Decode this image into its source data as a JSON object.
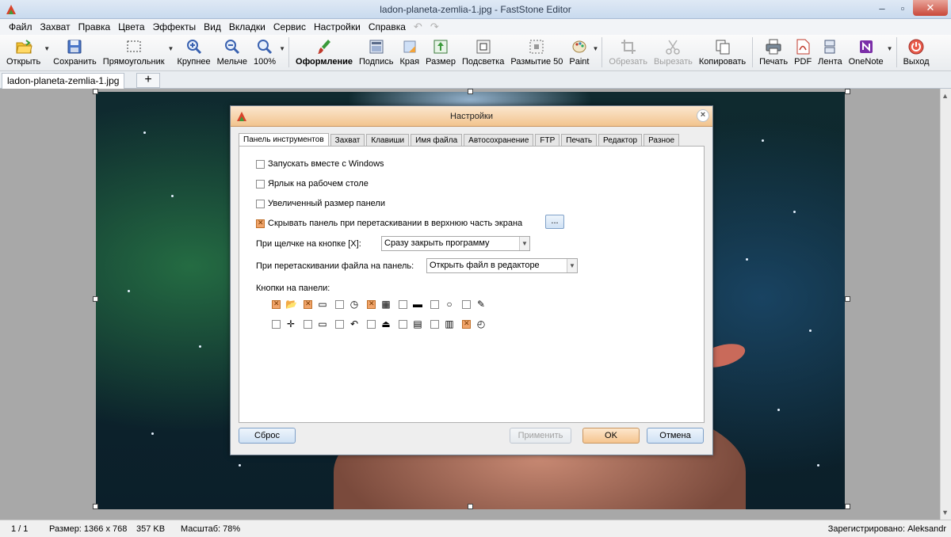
{
  "window": {
    "title": "ladon-planeta-zemlia-1.jpg - FastStone Editor"
  },
  "menu": [
    "Файл",
    "Захват",
    "Правка",
    "Цвета",
    "Эффекты",
    "Вид",
    "Вкладки",
    "Сервис",
    "Настройки",
    "Справка"
  ],
  "toolbar": {
    "open": "Открыть",
    "save": "Сохранить",
    "rect": "Прямоугольник",
    "zoom_in": "Крупнее",
    "zoom_out": "Мельче",
    "zoom_level": "100%",
    "decor": "Оформление",
    "caption": "Подпись",
    "edges": "Края",
    "resize": "Размер",
    "highlight": "Подсветка",
    "blur": "Размытие 50",
    "paint": "Paint",
    "crop": "Обрезать",
    "cut": "Вырезать",
    "copy": "Копировать",
    "print": "Печать",
    "pdf": "PDF",
    "tape": "Лента",
    "onenote": "OneNote",
    "exit": "Выход"
  },
  "tabs": {
    "file_tab": "ladon-planeta-zemlia-1.jpg",
    "add": "+"
  },
  "status": {
    "page": "1 / 1",
    "size": "Размер: 1366 x 768",
    "filesize": "357 KB",
    "zoom": "Масштаб: 78%",
    "registered": "Зарегистрировано: Aleksandr"
  },
  "dialog": {
    "title": "Настройки",
    "tabs": [
      "Панель инструментов",
      "Захват",
      "Клавиши",
      "Имя файла",
      "Автосохранение",
      "FTP",
      "Печать",
      "Редактор",
      "Разное"
    ],
    "options": [
      {
        "label": "Запускать вместе с Windows",
        "checked": false
      },
      {
        "label": "Ярлык на рабочем столе",
        "checked": false
      },
      {
        "label": "Увеличенный размер панели",
        "checked": false
      },
      {
        "label": "Скрывать панель при перетаскивании в верхнюю часть экрана",
        "checked": true
      }
    ],
    "more_btn": "...",
    "close_x_label": "При щелчке на кнопке [X]:",
    "close_x_value": "Сразу закрыть программу",
    "drag_label": "При перетаскивании файла на панель:",
    "drag_value": "Открыть файл в редакторе",
    "panel_buttons_label": "Кнопки на панели:",
    "panel_buttons": [
      [
        {
          "icon": "open-folder-icon",
          "glyph": "📂",
          "checked": true
        },
        {
          "icon": "rectangle-capture-icon",
          "glyph": "▭",
          "checked": true
        },
        {
          "icon": "timer-icon",
          "glyph": "◷",
          "checked": false
        },
        {
          "icon": "film-icon",
          "glyph": "▦",
          "checked": true
        },
        {
          "icon": "window-capture-icon",
          "glyph": "▬",
          "checked": false
        },
        {
          "icon": "magnifier-icon",
          "glyph": "○",
          "checked": false
        },
        {
          "icon": "color-picker-icon",
          "glyph": "✎",
          "checked": false
        }
      ],
      [
        {
          "icon": "crosshair-icon",
          "glyph": "✛",
          "checked": false
        },
        {
          "icon": "ruler-icon",
          "glyph": "▭",
          "checked": false
        },
        {
          "icon": "undo-icon",
          "glyph": "↶",
          "checked": false
        },
        {
          "icon": "scanner-icon",
          "glyph": "⏏",
          "checked": false
        },
        {
          "icon": "pdf-icon",
          "glyph": "▤",
          "checked": false
        },
        {
          "icon": "tape-icon",
          "glyph": "▥",
          "checked": false
        },
        {
          "icon": "stopwatch-icon",
          "glyph": "◴",
          "checked": true
        }
      ]
    ],
    "buttons": {
      "reset": "Сброс",
      "apply": "Применить",
      "ok": "OK",
      "cancel": "Отмена"
    }
  }
}
